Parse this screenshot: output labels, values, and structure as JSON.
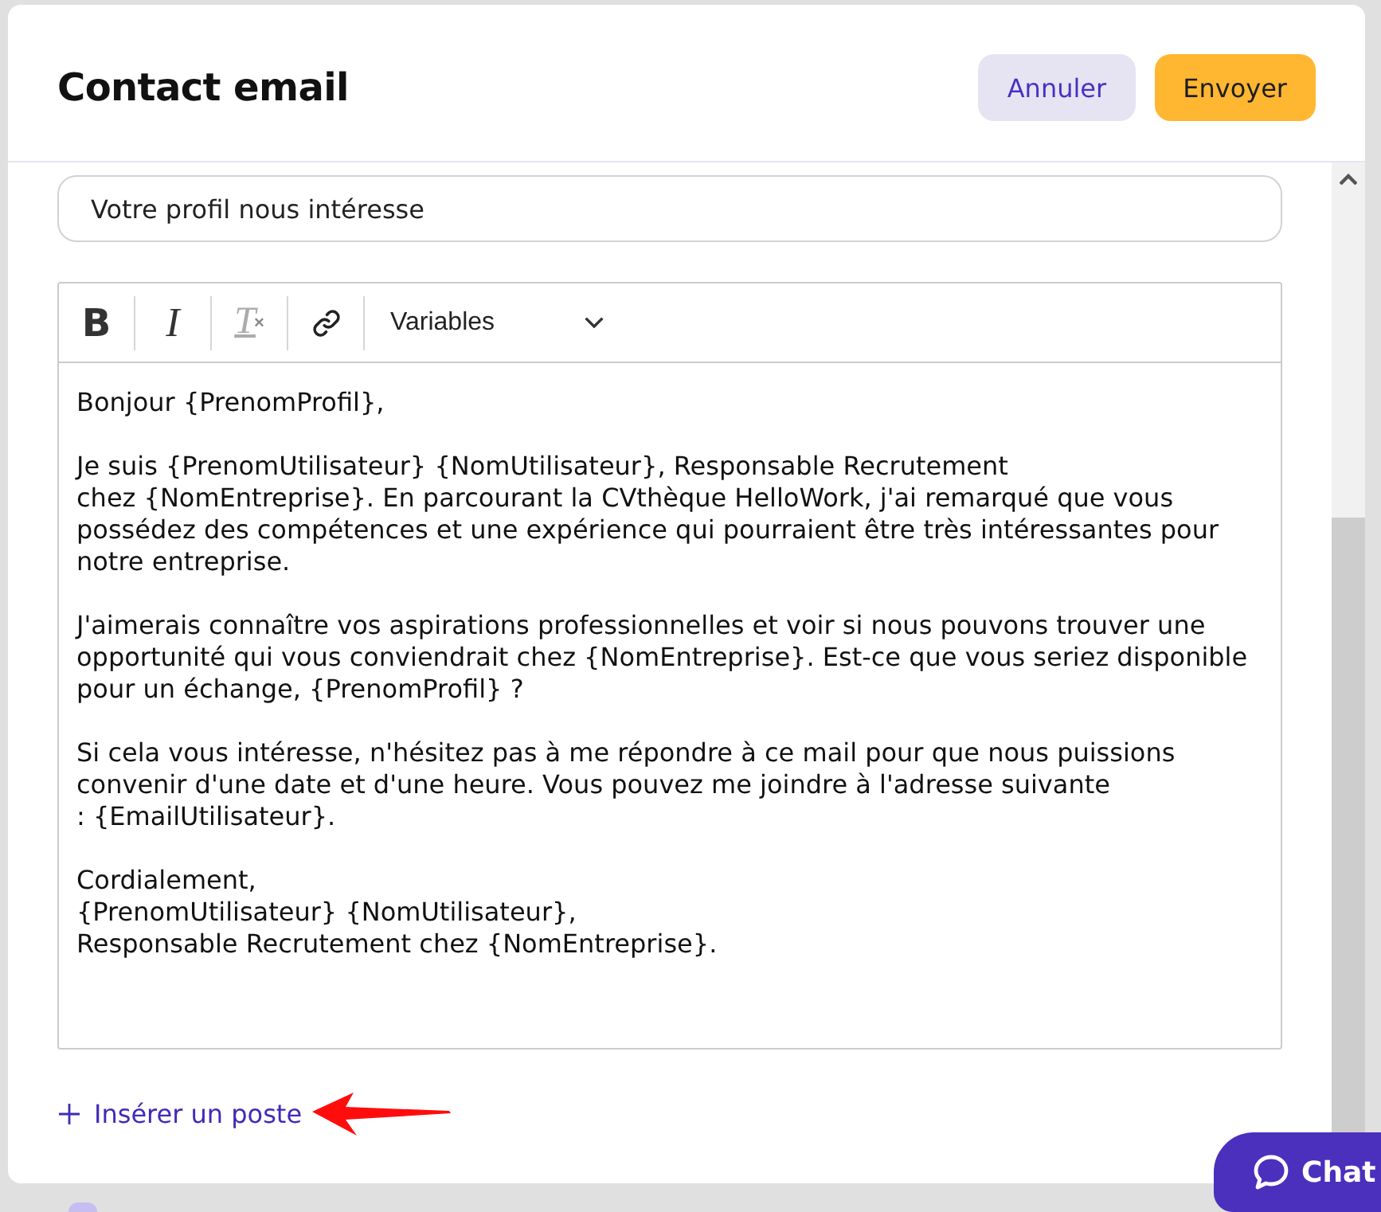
{
  "dialog": {
    "title": "Contact email",
    "buttons": [
      {
        "label": "Annuler",
        "kind": "secondary"
      },
      {
        "label": "Envoyer",
        "kind": "primary"
      }
    ]
  },
  "subject": {
    "value": "Votre profil nous intéresse"
  },
  "editor": {
    "toolbar": [
      {
        "kind": "bold",
        "glyph": "B",
        "disabled": false
      },
      {
        "kind": "italic",
        "glyph": "I",
        "disabled": false
      },
      {
        "kind": "clear-format",
        "glyph": "T",
        "sub": "×",
        "disabled": true
      },
      {
        "kind": "link",
        "disabled": false
      }
    ],
    "variables": {
      "label": "Variables"
    },
    "paragraphs": [
      [
        "Bonjour {PrenomProfil},"
      ],
      [
        "Je suis {PrenomUtilisateur} {NomUtilisateur}, Responsable Recrutement",
        "chez {NomEntreprise}. En parcourant la CVthèque HelloWork, j'ai remarqué que vous",
        "possédez des compétences et une expérience qui pourraient être très intéressantes pour",
        "notre entreprise."
      ],
      [
        "J'aimerais connaître vos aspirations professionnelles et voir si nous pouvons trouver une",
        "opportunité qui vous conviendrait chez {NomEntreprise}. Est-ce que vous seriez disponible",
        "pour un échange, {PrenomProfil} ?"
      ],
      [
        "Si cela vous intéresse, n'hésitez pas à me répondre à ce mail pour que nous puissions",
        "convenir d'une date et d'une heure. Vous pouvez me joindre à l'adresse suivante",
        ": {EmailUtilisateur}."
      ],
      [
        "Cordialement,",
        "{PrenomUtilisateur} {NomUtilisateur},",
        "Responsable Recrutement chez {NomEntreprise}."
      ]
    ]
  },
  "insert_link": {
    "label": "Insérer un poste"
  },
  "chat_button": {
    "label": "Chat"
  }
}
